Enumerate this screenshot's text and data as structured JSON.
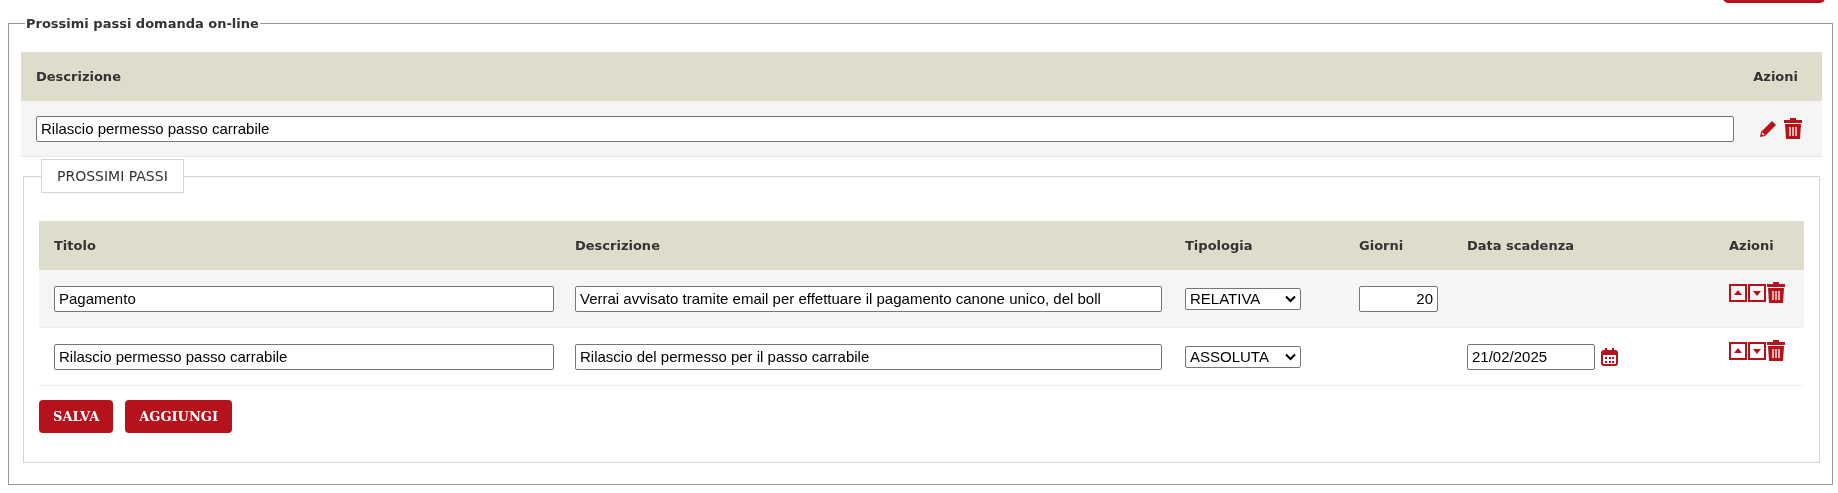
{
  "fieldset": {
    "legend": "Prossimi passi domanda on-line"
  },
  "main_table": {
    "columns": [
      "Descrizione",
      "Azioni"
    ],
    "rows": [
      {
        "descrizione": "Rilascio permesso passo carrabile"
      }
    ]
  },
  "steps": {
    "legend": "PROSSIMI PASSI",
    "columns": [
      "Titolo",
      "Descrizione",
      "Tipologia",
      "Giorni",
      "Data scadenza",
      "Azioni"
    ],
    "rows": [
      {
        "titolo": "Pagamento",
        "descrizione": "Verrai avvisato tramite email per effettuare il pagamento canone unico, del boll",
        "tipologia": "RELATIVA",
        "giorni": "20"
      },
      {
        "titolo": "Rilascio permesso passo carrabile",
        "descrizione": "Rilascio del permesso per il passo carrabile",
        "tipologia": "ASSOLUTA",
        "data_scadenza": "21/02/2025"
      }
    ]
  },
  "buttons": [
    "SALVA",
    "AGGIUNGI"
  ]
}
